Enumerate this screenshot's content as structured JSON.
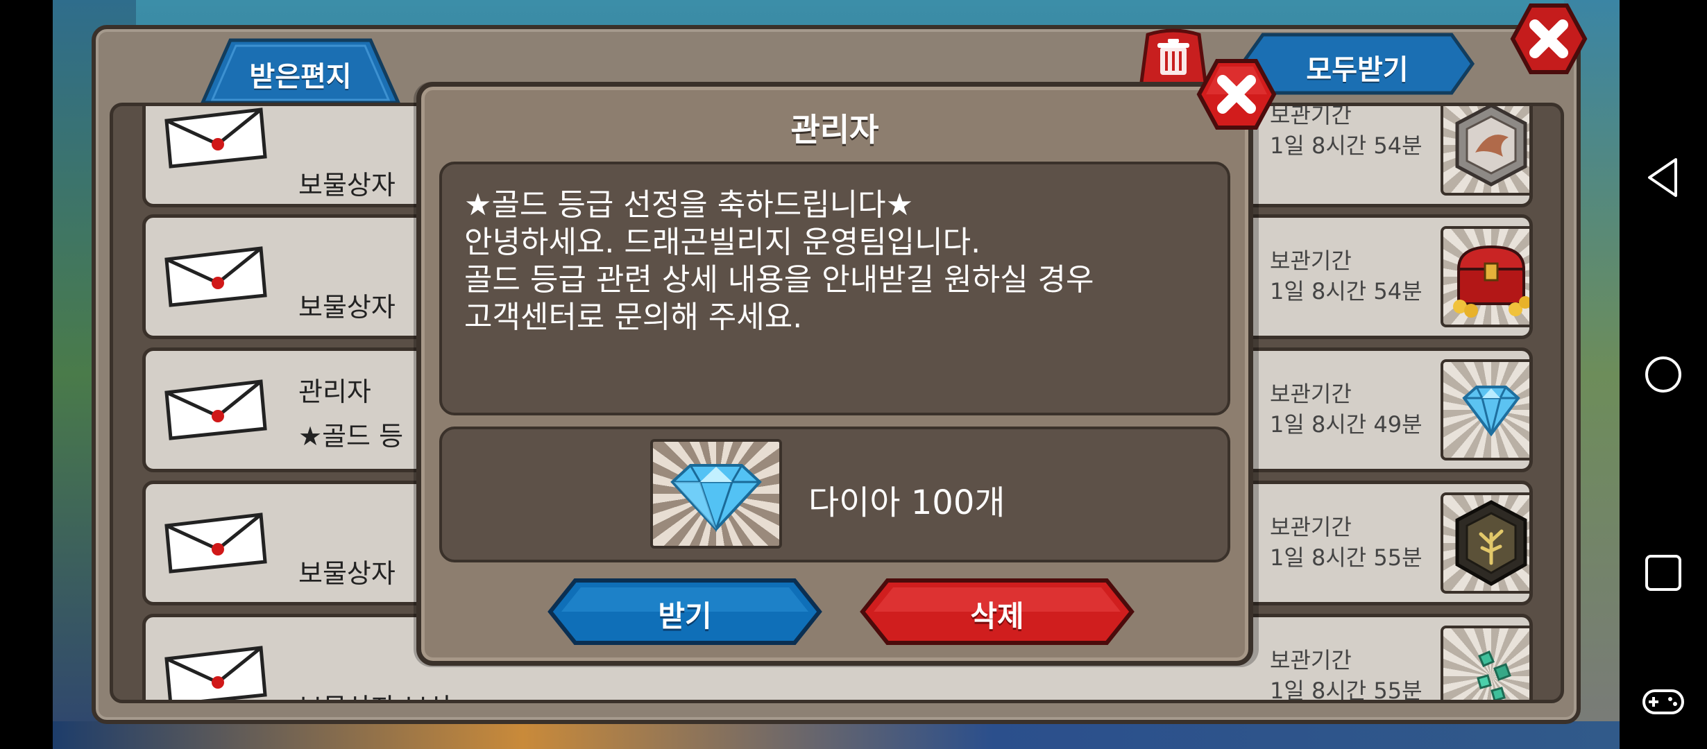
{
  "mailbox": {
    "tab_label": "받은편지",
    "claim_all_label": "모두받기",
    "rows": [
      {
        "sender": "",
        "title": "보물상자",
        "expiry_label": "보관기간",
        "expiry_time": "1일 8시간 54분",
        "item_icon": "dragon-emblem-icon"
      },
      {
        "sender": "",
        "title": "보물상자",
        "expiry_label": "보관기간",
        "expiry_time": "1일 8시간 54분",
        "item_icon": "treasure-chest-icon"
      },
      {
        "sender": "관리자",
        "title": "★골드 등",
        "expiry_label": "보관기간",
        "expiry_time": "1일 8시간 49분",
        "item_icon": "diamond-icon"
      },
      {
        "sender": "",
        "title": "보물상자",
        "expiry_label": "보관기간",
        "expiry_time": "1일 8시간 55분",
        "item_icon": "tree-shield-icon"
      },
      {
        "sender": "",
        "title": "보물상자 보상",
        "expiry_label": "보관기간",
        "expiry_time": "1일 8시간 55분",
        "item_icon": "gem-shards-icon"
      }
    ]
  },
  "modal": {
    "title": "관리자",
    "message": {
      "line1": "★골드 등급 선정을 축하드립니다★",
      "line2": "안녕하세요. 드래곤빌리지 운영팀입니다.",
      "line3": "골드 등급 관련 상세 내용을 안내받길 원하실 경우",
      "line4": "고객센터로 문의해 주세요."
    },
    "reward": {
      "label": "다이아 100개",
      "icon": "diamond-icon"
    },
    "receive_label": "받기",
    "delete_label": "삭제"
  },
  "colors": {
    "blue_button": "#0f6fb8",
    "red_button": "#d01e1e",
    "panel": "#8d7e6f",
    "text_box": "#5d5148"
  },
  "navbar": {
    "icons": [
      "back-icon",
      "home-icon",
      "recents-icon",
      "gamepad-icon"
    ]
  }
}
